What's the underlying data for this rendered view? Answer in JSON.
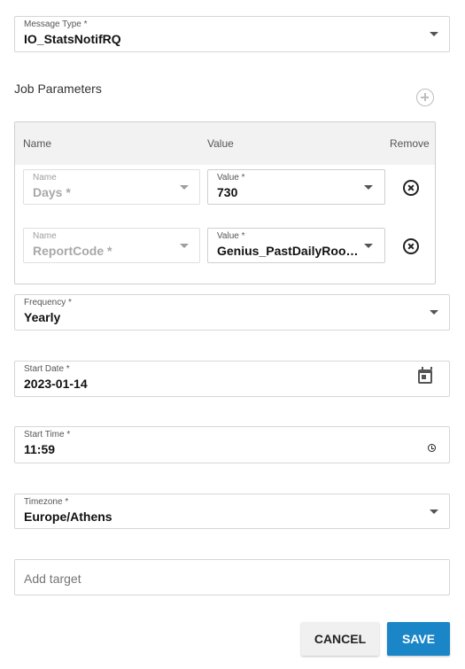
{
  "message_type": {
    "label": "Message Type *",
    "value": "IO_StatsNotifRQ"
  },
  "job_parameters": {
    "title": "Job Parameters",
    "columns": {
      "name": "Name",
      "value": "Value",
      "remove": "Remove"
    },
    "rows": [
      {
        "name_label": "Name",
        "name_value": "Days *",
        "value_label": "Value *",
        "value_value": "730"
      },
      {
        "name_label": "Name",
        "name_value": "ReportCode *",
        "value_label": "Value *",
        "value_value": "Genius_PastDailyRoom..."
      }
    ]
  },
  "frequency": {
    "label": "Frequency *",
    "value": "Yearly"
  },
  "start_date": {
    "label": "Start Date *",
    "value": "2023-01-14"
  },
  "start_time": {
    "label": "Start Time *",
    "value": "11:59"
  },
  "timezone": {
    "label": "Timezone *",
    "value": "Europe/Athens"
  },
  "add_target": {
    "placeholder": "Add target"
  },
  "actions": {
    "cancel": "CANCEL",
    "save": "SAVE"
  },
  "colors": {
    "primary": "#1a86c8",
    "border": "#d6d6d6",
    "header_bg": "#f2f2f2"
  },
  "icons": [
    "chevron-down-icon",
    "add-circle-icon",
    "remove-circle-icon",
    "calendar-icon",
    "clock-icon"
  ]
}
